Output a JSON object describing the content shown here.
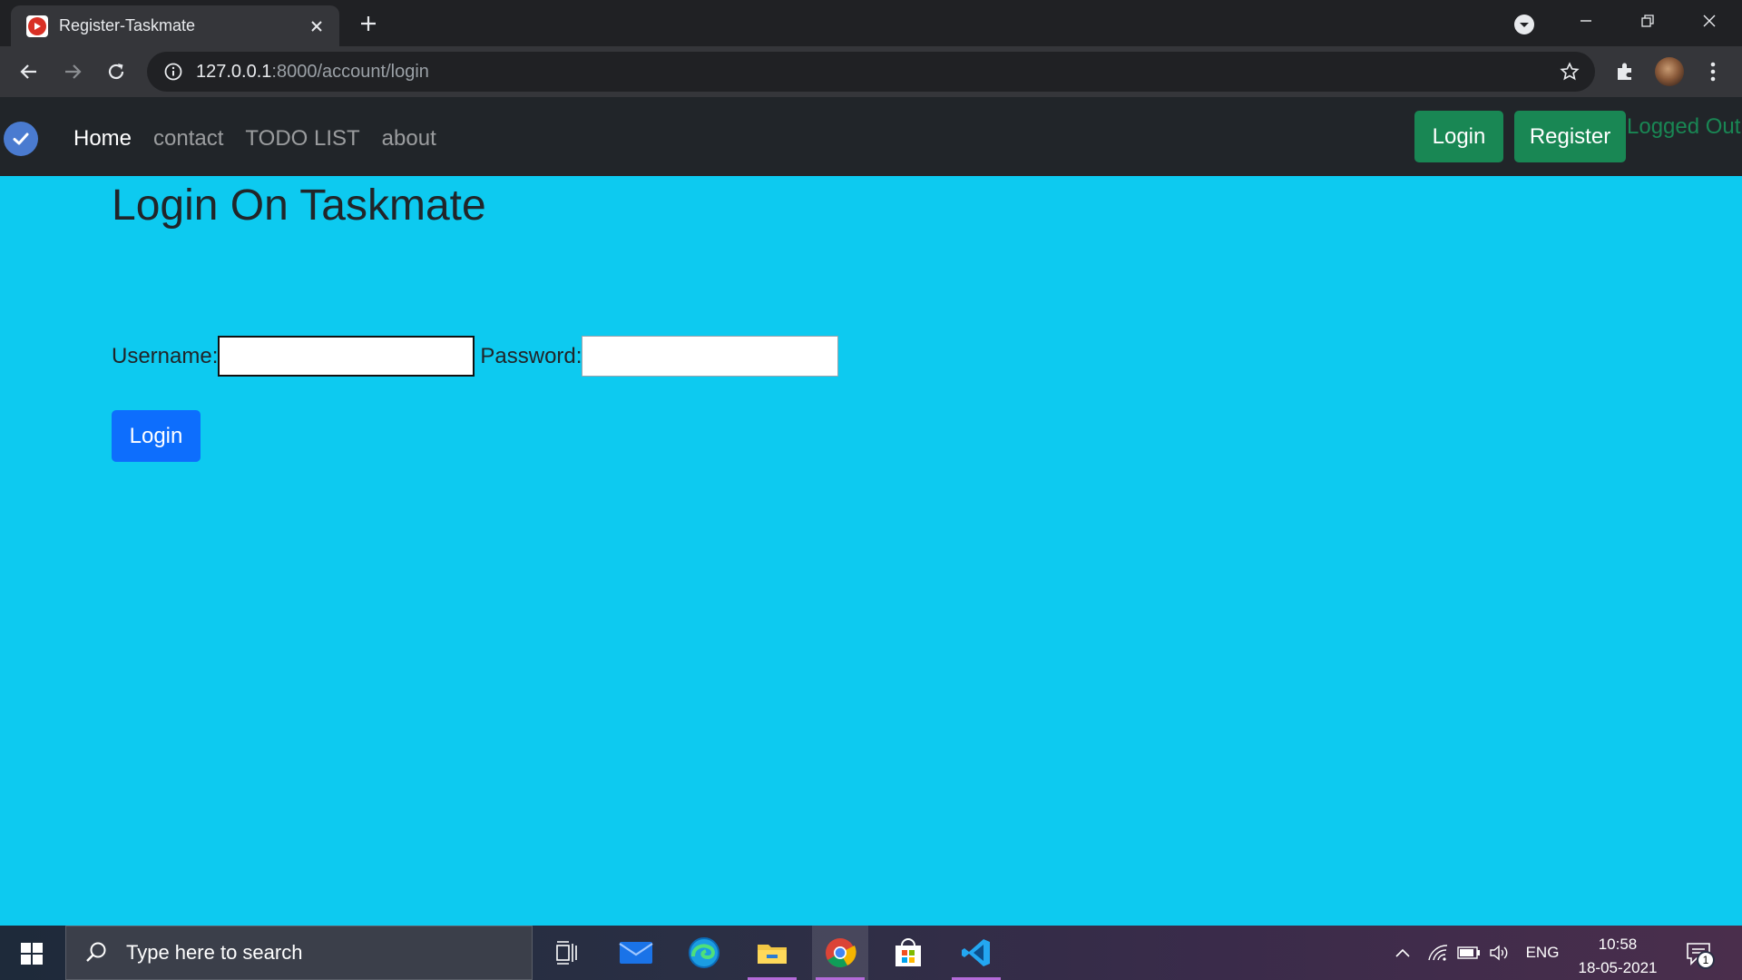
{
  "browser": {
    "tab_title": "Register-Taskmate",
    "url_host": "127.0.0.1",
    "url_path": ":8000/account/login"
  },
  "navbar": {
    "links": [
      {
        "label": "Home",
        "active": true
      },
      {
        "label": "contact"
      },
      {
        "label": "TODO LIST"
      },
      {
        "label": "about"
      }
    ],
    "login_label": "Login",
    "register_label": "Register",
    "status_text": "Logged Out"
  },
  "page": {
    "title": "Login On Taskmate",
    "username_label": "Username:",
    "username_value": "",
    "password_label": "Password:",
    "password_value": "",
    "submit_label": "Login",
    "background": "#0dcaf0"
  },
  "taskbar": {
    "search_placeholder": "Type here to search",
    "language": "ENG",
    "time": "10:58",
    "date": "18-05-2021",
    "notification_count": "1"
  },
  "colors": {
    "success": "#198754",
    "primary": "#0d6efd",
    "navbar": "#212529"
  }
}
